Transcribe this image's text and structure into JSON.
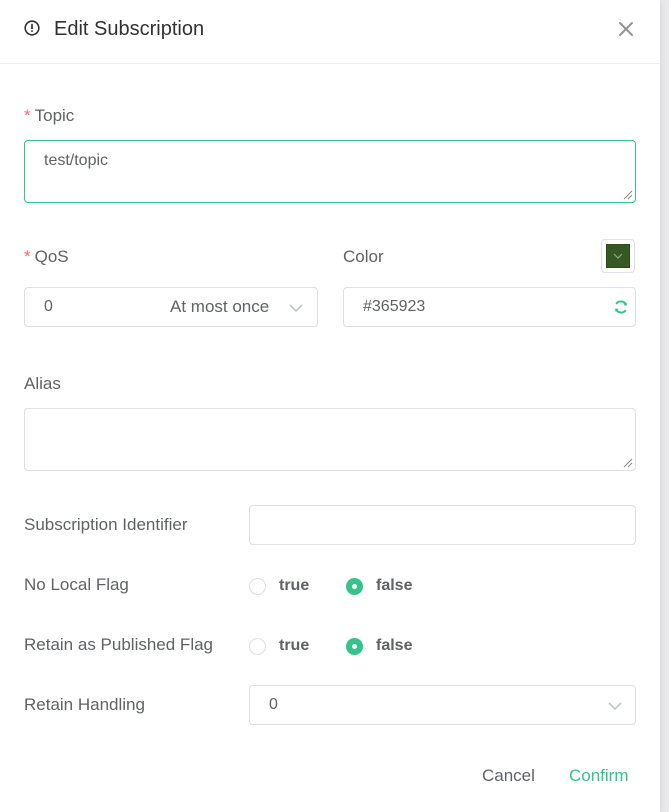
{
  "dialog": {
    "title": "Edit Subscription",
    "header_icon": "info-circle-icon",
    "close_icon": "close-icon"
  },
  "form": {
    "required_mark": "*",
    "topic": {
      "label": "Topic",
      "value": "test/topic"
    },
    "qos": {
      "label": "QoS",
      "value": "0",
      "description": "At most once"
    },
    "color": {
      "label": "Color",
      "value": "#365923",
      "swatch": "#365923"
    },
    "alias": {
      "label": "Alias",
      "value": ""
    },
    "subscription_identifier": {
      "label": "Subscription Identifier",
      "value": ""
    },
    "no_local_flag": {
      "label": "No Local Flag",
      "options": [
        "true",
        "false"
      ],
      "selected": "false"
    },
    "retain_as_published_flag": {
      "label": "Retain as Published Flag",
      "options": [
        "true",
        "false"
      ],
      "selected": "false"
    },
    "retain_handling": {
      "label": "Retain Handling",
      "value": "0"
    }
  },
  "footer": {
    "cancel_label": "Cancel",
    "confirm_label": "Confirm"
  },
  "colors": {
    "accent": "#34c388",
    "required": "#f56c6c",
    "border": "#dcdfe6"
  }
}
